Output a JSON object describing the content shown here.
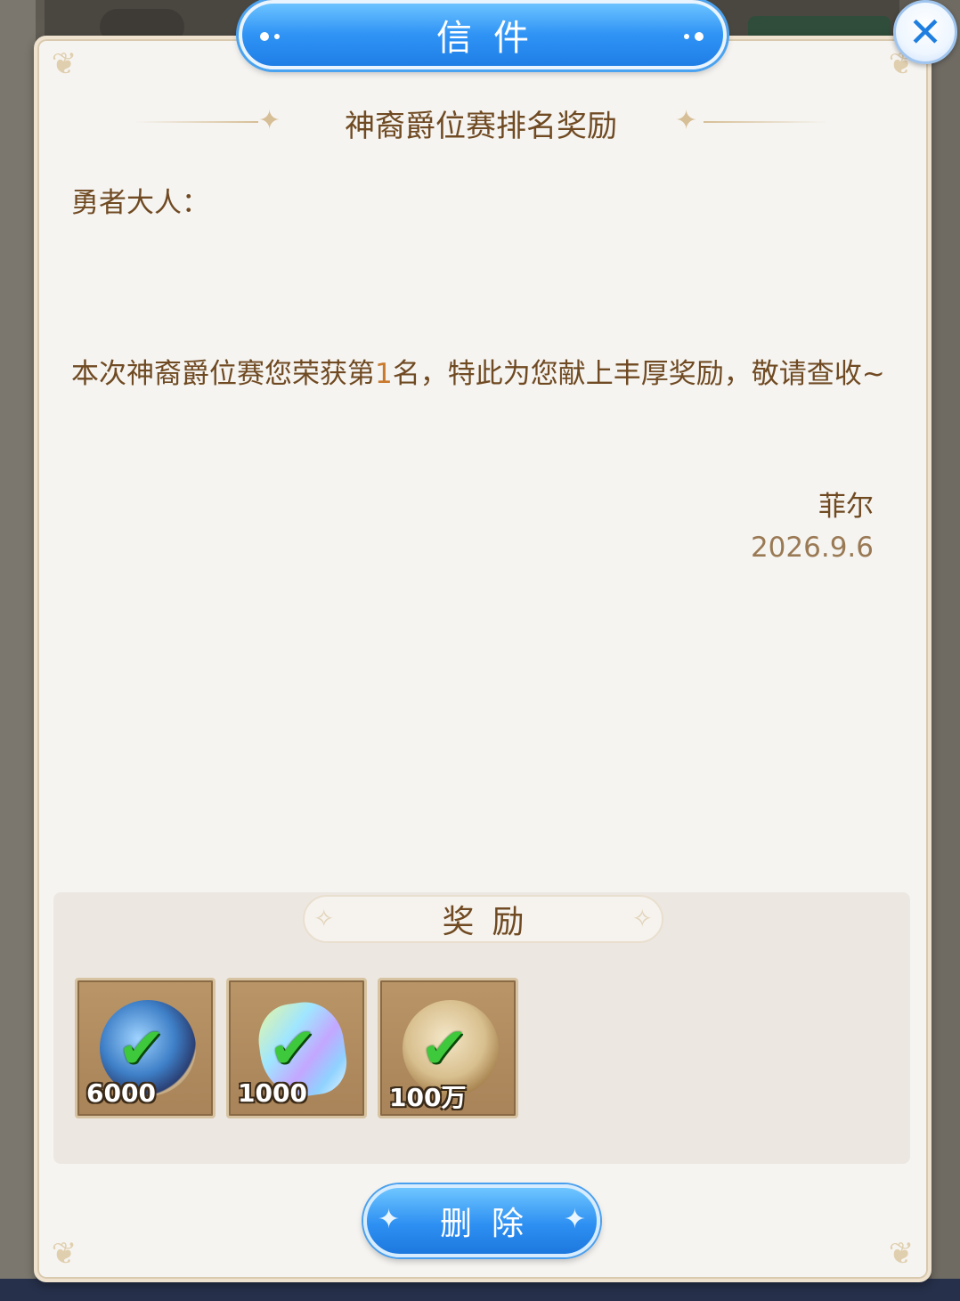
{
  "window": {
    "title": "信件"
  },
  "mail": {
    "heading": "神裔爵位赛排名奖励",
    "greeting": "勇者大人：",
    "message_before": "本次神裔爵位赛您荣获第",
    "rank": "1",
    "message_after": "名，特此为您献上丰厚奖励，敬请查收~",
    "signature": "菲尔",
    "date": "2026.9.6"
  },
  "rewards": {
    "label": "奖励",
    "items": [
      {
        "icon": "medal-icon",
        "quantity": "6000",
        "claimed": true
      },
      {
        "icon": "crystal-icon",
        "quantity": "1000",
        "claimed": true
      },
      {
        "icon": "gold-coin-icon",
        "quantity": "100万",
        "claimed": true
      }
    ]
  },
  "actions": {
    "delete_label": "删除"
  },
  "colors": {
    "text": "#6f4a22",
    "accent_blue": "#2e90f2",
    "highlight": "#c9792b",
    "check": "#3ec83b"
  }
}
